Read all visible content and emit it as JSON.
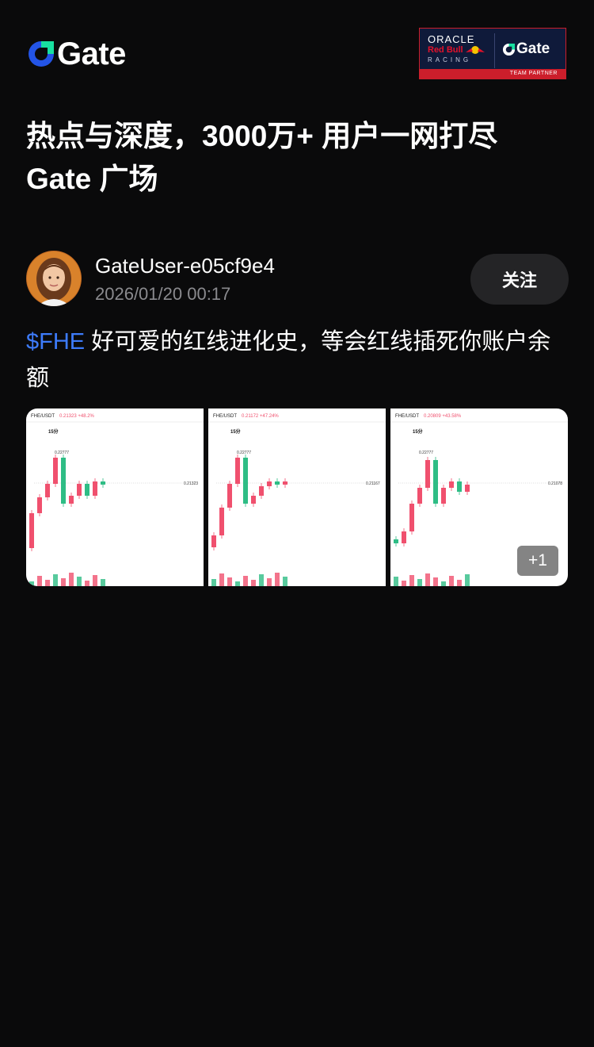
{
  "header": {
    "logo_text": "Gate",
    "partner": {
      "oracle": "ORACLE",
      "redbull": "Red Bull",
      "racing": "RACING",
      "gate": "Gate",
      "strip": "TEAM PARTNER"
    }
  },
  "headline": {
    "line1": "热点与深度，3000万+ 用户一网打尽",
    "line2": "Gate 广场"
  },
  "post": {
    "username": "GateUser-e05cf9e4",
    "timestamp": "2026/01/20 00:17",
    "follow_label": "关注",
    "ticker": "$FHE",
    "text": " 好可爱的红线进化史，等会红线插死你账户余额",
    "images": [
      {
        "pair": "FHE/USDT",
        "change": "0.21323 +48.2%",
        "tab_active": "15分",
        "peak_label": "0.22777",
        "price_tag": "0.21323"
      },
      {
        "pair": "FHE/USDT",
        "change": "0.21172 +47.24%",
        "tab_active": "15分",
        "peak_label": "0.22777",
        "price_tag": "0.21167"
      },
      {
        "pair": "FHE/USDT",
        "change": "0.20809 +43.58%",
        "tab_active": "15分",
        "peak_label": "0.22777",
        "price_tag": "0.21078"
      }
    ],
    "more_count": "+1"
  },
  "colors": {
    "background": "#0a0a0b",
    "accent": "#3d7bfa",
    "follow_bg": "#242426",
    "up": "#2ebd85",
    "down": "#f0506e"
  }
}
